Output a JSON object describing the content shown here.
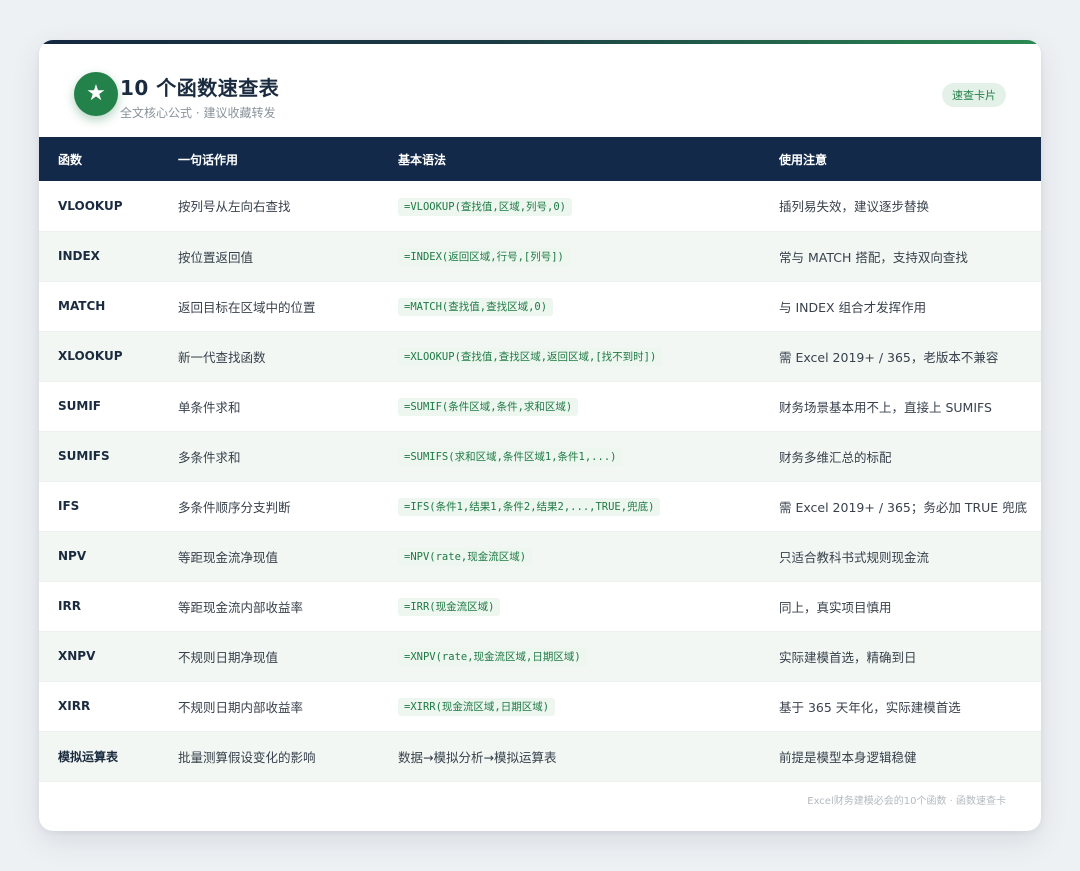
{
  "header": {
    "badge_icon": "★",
    "title": "10 个函数速查表",
    "subtitle": "全文核心公式 · 建议收藏转发",
    "tag": "速查卡片"
  },
  "table": {
    "columns": [
      "函数",
      "一句话作用",
      "基本语法",
      "使用注意"
    ],
    "rows": [
      {
        "fn": "VLOOKUP",
        "desc": "按列号从左向右查找",
        "syntax": "=VLOOKUP(查找值,区域,列号,0)",
        "note": "插列易失效，建议逐步替换"
      },
      {
        "fn": "INDEX",
        "desc": "按位置返回值",
        "syntax": "=INDEX(返回区域,行号,[列号])",
        "note": "常与 MATCH 搭配，支持双向查找"
      },
      {
        "fn": "MATCH",
        "desc": "返回目标在区域中的位置",
        "syntax": "=MATCH(查找值,查找区域,0)",
        "note": "与 INDEX 组合才发挥作用"
      },
      {
        "fn": "XLOOKUP",
        "desc": "新一代查找函数",
        "syntax": "=XLOOKUP(查找值,查找区域,返回区域,[找不到时])",
        "note": "需 Excel 2019+ / 365，老版本不兼容"
      },
      {
        "fn": "SUMIF",
        "desc": "单条件求和",
        "syntax": "=SUMIF(条件区域,条件,求和区域)",
        "note": "财务场景基本用不上，直接上 SUMIFS"
      },
      {
        "fn": "SUMIFS",
        "desc": "多条件求和",
        "syntax": "=SUMIFS(求和区域,条件区域1,条件1,...)",
        "note": "财务多维汇总的标配"
      },
      {
        "fn": "IFS",
        "desc": "多条件顺序分支判断",
        "syntax": "=IFS(条件1,结果1,条件2,结果2,...,TRUE,兜底)",
        "note": "需 Excel 2019+ / 365；务必加 TRUE 兜底"
      },
      {
        "fn": "NPV",
        "desc": "等距现金流净现值",
        "syntax": "=NPV(rate,现金流区域)",
        "note": "只适合教科书式规则现金流"
      },
      {
        "fn": "IRR",
        "desc": "等距现金流内部收益率",
        "syntax": "=IRR(现金流区域)",
        "note": "同上，真实项目慎用"
      },
      {
        "fn": "XNPV",
        "desc": "不规则日期净现值",
        "syntax": "=XNPV(rate,现金流区域,日期区域)",
        "note": "实际建模首选，精确到日"
      },
      {
        "fn": "XIRR",
        "desc": "不规则日期内部收益率",
        "syntax": "=XIRR(现金流区域,日期区域)",
        "note": "基于 365 天年化，实际建模首选"
      },
      {
        "fn": "模拟运算表",
        "desc": "批量测算假设变化的影响",
        "syntax_plain": "数据→模拟分析→模拟运算表",
        "note": "前提是模型本身逻辑稳健"
      }
    ]
  },
  "footer": "Excel财务建模必会的10个函数 · 函数速查卡",
  "colors": {
    "header_bg": "#13294a",
    "accent_green": "#23814a",
    "stripe": "#f2f7f3"
  }
}
